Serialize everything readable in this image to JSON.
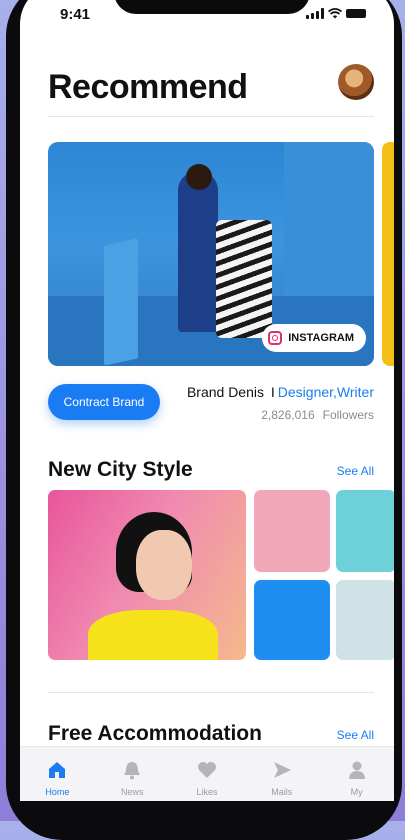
{
  "status": {
    "time": "9:41"
  },
  "header": {
    "title": "Recommend"
  },
  "hero": {
    "badge_label": "INSTAGRAM"
  },
  "brand": {
    "button_label": "Contract Brand",
    "name": "Brand Denis",
    "separator": "I",
    "roles": "Designer,Writer",
    "followers_count": "2,826,016",
    "followers_label": "Followers"
  },
  "sections": [
    {
      "title": "New City Style",
      "see_all": "See All"
    },
    {
      "title": "Free Accommodation",
      "see_all": "See All"
    }
  ],
  "tabs": [
    {
      "label": "Home",
      "icon": "home-icon",
      "active": true
    },
    {
      "label": "News",
      "icon": "bell-icon",
      "active": false
    },
    {
      "label": "Likes",
      "icon": "heart-icon",
      "active": false
    },
    {
      "label": "Mails",
      "icon": "send-icon",
      "active": false
    },
    {
      "label": "My",
      "icon": "user-icon",
      "active": false
    }
  ],
  "colors": {
    "accent": "#1a7cf2",
    "text": "#111111",
    "muted": "#8a8a94"
  }
}
